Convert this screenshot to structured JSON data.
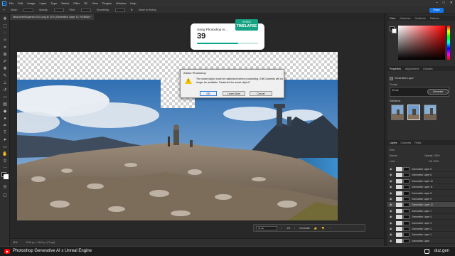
{
  "menubar": {
    "app_icon": "Ps",
    "items": [
      "File",
      "Edit",
      "Image",
      "Layer",
      "Type",
      "Select",
      "Filter",
      "3D",
      "View",
      "Plugins",
      "Window",
      "Help"
    ]
  },
  "options_bar": {
    "items": [
      "Mode:",
      "Opacity:",
      "Flow:",
      "Smoothing:",
      "Erase to History"
    ],
    "share_label": "Share"
  },
  "document": {
    "tab_title": "NewLevelSequence.0011.png @ 11% (Generative Layer 12, RGB/8#) *",
    "zoom": "11%",
    "status_info": "3246 px x 1440 px (72 ppi)"
  },
  "dialog": {
    "title": "Adobe Photoshop",
    "message": "The smart object must be rasterized before proceeding.  Edit Contents will no longer be available.  Rasterize the smart object?",
    "ok": "OK",
    "learn_more": "Learn More",
    "cancel": "Cancel"
  },
  "timelapse_card": {
    "title": "Using Photoshop AI...",
    "count": "39",
    "progress": 0.68,
    "badge_top": "SPEED",
    "badge_main": "TIMELAPSE"
  },
  "context_bar": {
    "prompt_value": "39 car",
    "counter": "1/3",
    "generate": "Generate"
  },
  "panels": {
    "color_tabs": [
      "Color",
      "Swatches",
      "Gradients",
      "Patterns"
    ],
    "properties_tabs": [
      "Properties",
      "Adjustments",
      "Libraries"
    ],
    "layer_type": "Generative Layer",
    "prompt_label": "Prompt",
    "prompt_value": "39 car",
    "generate_label": "Generate",
    "variations_label": "Variations"
  },
  "layers_panel": {
    "tabs": [
      "Layers",
      "Channels",
      "Paths"
    ],
    "kind_label": "Kind",
    "blend_mode": "Normal",
    "opacity": "Opacity: 100%",
    "lock_label": "Lock:",
    "fill": "Fill: 100%",
    "layers": [
      {
        "name": "Generative Layer 5",
        "selected": false
      },
      {
        "name": "Generative Layer 6",
        "selected": false
      },
      {
        "name": "Generative Layer 10",
        "selected": false
      },
      {
        "name": "Generative Layer 11",
        "selected": false
      },
      {
        "name": "Generative Layer 8",
        "selected": false
      },
      {
        "name": "Generative Layer 9",
        "selected": false
      },
      {
        "name": "Generative Layer 12",
        "selected": true
      },
      {
        "name": "Generative Layer 7",
        "selected": false
      },
      {
        "name": "Generative Layer 4",
        "selected": false
      },
      {
        "name": "Generative Layer 3",
        "selected": false
      },
      {
        "name": "Generative Layer 2",
        "selected": false
      },
      {
        "name": "Generative Layer 1",
        "selected": false
      },
      {
        "name": "Generative Layer",
        "selected": false
      }
    ]
  },
  "video_bar": {
    "title": "Photoshop Generative AI  x  Unreal Engine",
    "handle": "duz.gen"
  },
  "colors": {
    "accent": "#1473e6",
    "timelapse_green": "#16a383",
    "warning_yellow": "#f2c500"
  }
}
